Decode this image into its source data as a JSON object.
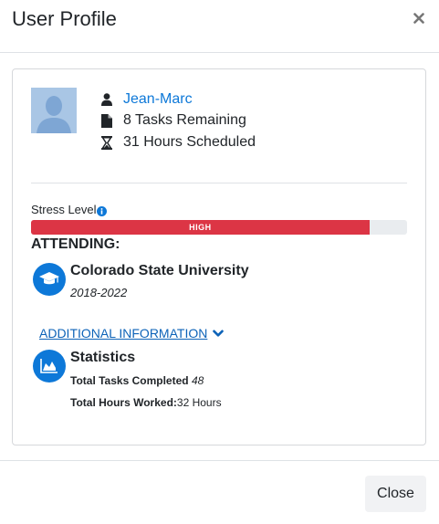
{
  "modal": {
    "title": "User Profile",
    "close_button_label": "Close"
  },
  "user": {
    "name": "Jean-Marc",
    "tasks_remaining": "8 Tasks Remaining",
    "hours_scheduled": "31 Hours Scheduled"
  },
  "stress": {
    "label": "Stress Level",
    "level_text": "HIGH",
    "level_fraction": 0.9,
    "bar_color": "#dc3545"
  },
  "education": {
    "heading": "ATTENDING:",
    "school": "Colorado State University",
    "years": "2018-2022"
  },
  "additional": {
    "link_label": "ADDITIONAL INFORMATION"
  },
  "statistics": {
    "title": "Statistics",
    "tasks_completed_label": "Total Tasks Completed",
    "tasks_completed_value": "48",
    "hours_worked_label": "Total Hours Worked:",
    "hours_worked_value": "32 Hours"
  },
  "colors": {
    "accent": "#0d78d8",
    "danger": "#dc3545"
  },
  "icons": [
    "close-icon",
    "user-icon",
    "file-icon",
    "hourglass-icon",
    "info-icon",
    "graduation-cap-icon",
    "chevron-down-icon",
    "area-chart-icon"
  ]
}
